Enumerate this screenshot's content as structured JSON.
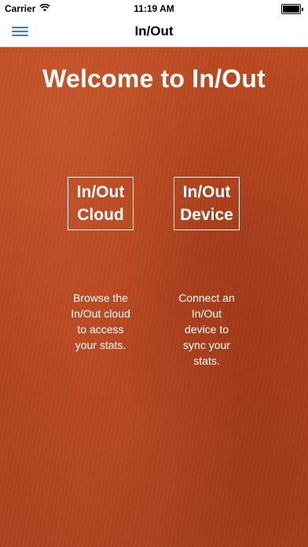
{
  "status_bar": {
    "carrier": "Carrier",
    "time": "11:19 AM",
    "icons": [
      "wifi-icon",
      "battery-icon"
    ]
  },
  "nav": {
    "title": "In/Out",
    "menu_icon": "hamburger-menu-icon",
    "accent_color": "#3478f6"
  },
  "main": {
    "background_color": "#b84a22",
    "welcome": "Welcome to In/Out",
    "options": [
      {
        "button_lines": [
          "In/Out",
          "Cloud"
        ],
        "description_lines": [
          "Browse the",
          "In/Out cloud",
          "to access",
          "your stats."
        ]
      },
      {
        "button_lines": [
          "In/Out",
          "Device"
        ],
        "description_lines": [
          "Connect an",
          "In/Out",
          "device to",
          "sync your",
          "stats."
        ]
      }
    ]
  }
}
